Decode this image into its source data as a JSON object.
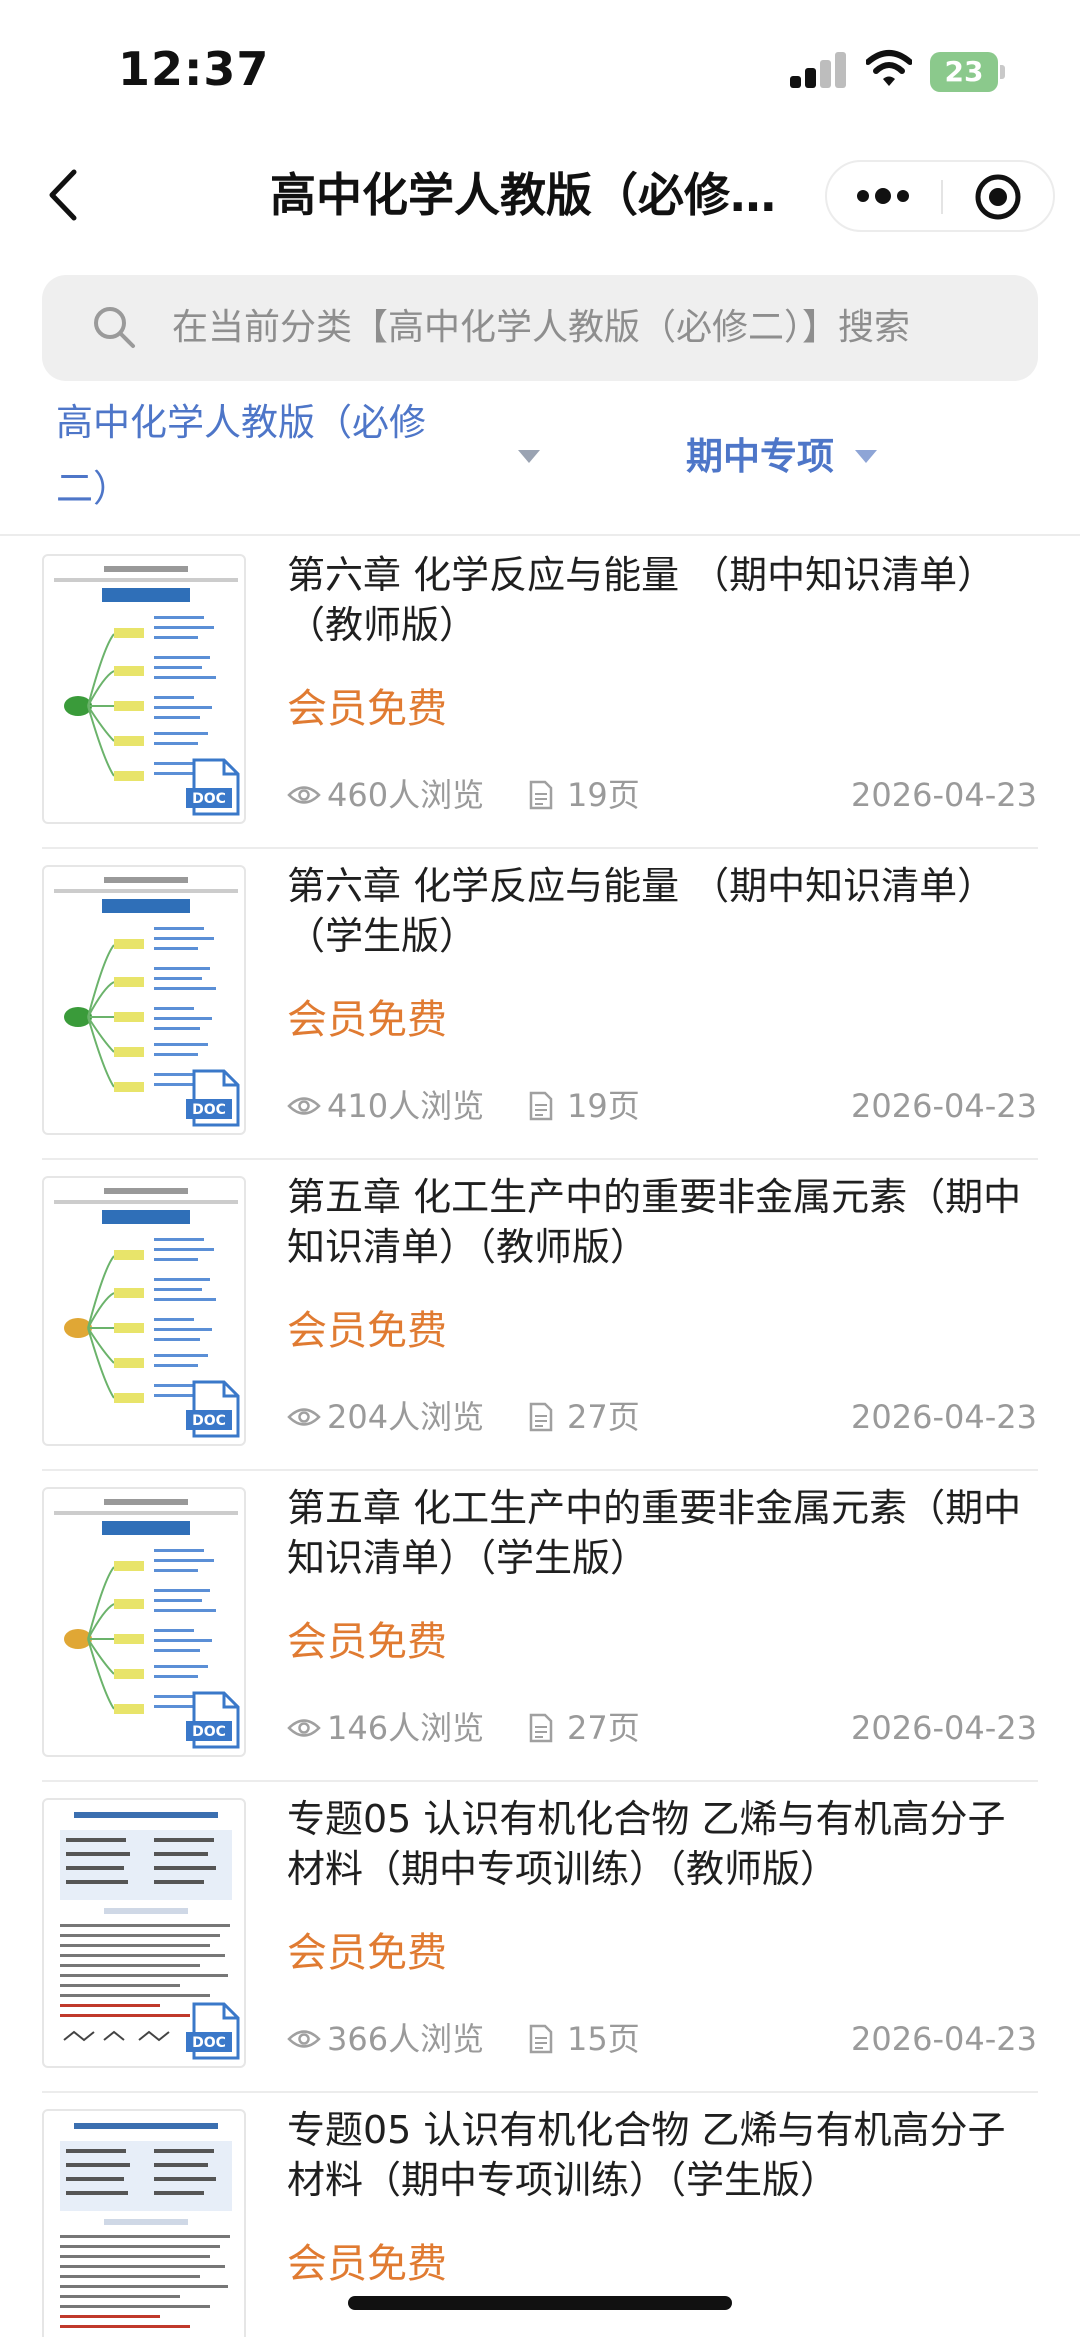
{
  "status_bar": {
    "time": "12:37",
    "battery": "23"
  },
  "nav": {
    "title": "高中化学人教版（必修…"
  },
  "search": {
    "placeholder": "在当前分类【高中化学人教版（必修二）】搜索"
  },
  "filters": {
    "category_line1": "高中化学人教版（必修",
    "category_line2": "二）",
    "topic": "期中专项"
  },
  "items": [
    {
      "title_line1": "第六章 化学反应与能量 （期中知识清单）",
      "title_line2": "（教师版）",
      "price": "会员免费",
      "views": "460人浏览",
      "pages": "19页",
      "date": "2026-04-23",
      "badge": "DOC"
    },
    {
      "title_line1": "第六章 化学反应与能量 （期中知识清单）",
      "title_line2": "（学生版）",
      "price": "会员免费",
      "views": "410人浏览",
      "pages": "19页",
      "date": "2026-04-23",
      "badge": "DOC"
    },
    {
      "title_line1": "第五章 化工生产中的重要非金属元素（期中",
      "title_line2": "知识清单）（教师版）",
      "price": "会员免费",
      "views": "204人浏览",
      "pages": "27页",
      "date": "2026-04-23",
      "badge": "DOC"
    },
    {
      "title_line1": "第五章 化工生产中的重要非金属元素（期中",
      "title_line2": "知识清单）（学生版）",
      "price": "会员免费",
      "views": "146人浏览",
      "pages": "27页",
      "date": "2026-04-23",
      "badge": "DOC"
    },
    {
      "title_line1": "专题05 认识有机化合物 乙烯与有机高分子",
      "title_line2": "材料（期中专项训练）（教师版）",
      "price": "会员免费",
      "views": "366人浏览",
      "pages": "15页",
      "date": "2026-04-23",
      "badge": "DOC"
    },
    {
      "title_line1": "专题05 认识有机化合物 乙烯与有机高分子",
      "title_line2": "材料（期中专项训练）（学生版）",
      "price": "会员免费",
      "views": "",
      "pages": "",
      "date": "",
      "badge": ""
    }
  ],
  "colors": {
    "accent_blue": "#4e76c8",
    "price_orange": "#e07b32",
    "search_bg": "#efefef",
    "doc_badge": "#3a78c9"
  },
  "icons": [
    "back-arrow-icon",
    "more-dots-icon",
    "close-circle-icon",
    "search-icon",
    "caret-down-icon",
    "eye-icon",
    "page-icon",
    "doc-badge-icon"
  ]
}
